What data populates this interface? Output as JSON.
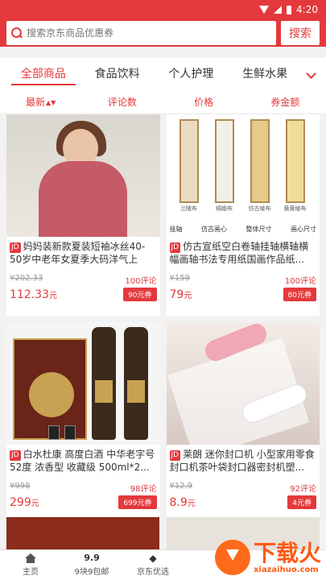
{
  "status": {
    "time": "4:20"
  },
  "header": {
    "search_placeholder": "搜索京东商品优惠券",
    "search_button": "搜索"
  },
  "categories": [
    "全部商品",
    "食品饮料",
    "个人护理",
    "生鲜水果"
  ],
  "sort_tabs": [
    "最新",
    "评论数",
    "价格",
    "券金额"
  ],
  "products": [
    {
      "badge": "JD",
      "title": "妈妈装新款夏装短袖冰丝40-50岁中老年女夏季大码洋气上衣...",
      "old_price": "¥202.33",
      "price": "112.33",
      "price_unit": "元",
      "comments": "100评论",
      "coupon": "90元券"
    },
    {
      "badge": "JD",
      "title": "仿古宣纸空白卷轴挂轴横轴横幅画轴书法专用纸国画作品纸...",
      "old_price": "¥159",
      "price": "79",
      "price_unit": "元",
      "comments": "100评论",
      "coupon": "80元券"
    },
    {
      "badge": "JD",
      "title": "白水杜康 高度白酒 中华老字号52度 浓香型 收藏级 500ml*2...",
      "old_price": "¥998",
      "price": "299",
      "price_unit": "元",
      "comments": "98评论",
      "coupon": "699元券"
    },
    {
      "badge": "JD",
      "title": "莱朗 迷你封口机 小型家用零食封口机茶叶袋封口器密封机塑...",
      "old_price": "¥12.9",
      "price": "8.9",
      "price_unit": "元",
      "comments": "92评论",
      "coupon": "4元券"
    }
  ],
  "scroll_labels": [
    "兰陵布",
    "绸缎布",
    "仿古绫布",
    "黄黄绫布"
  ],
  "scroll_captions": [
    "挂轴",
    "仿古画心",
    "整体尺寸",
    "画心尺寸"
  ],
  "tabbar": [
    {
      "label": "主页",
      "icon": "home-icon"
    },
    {
      "label": "9块9包邮",
      "icon": "nine-nine-icon",
      "glyph": "9.9"
    },
    {
      "label": "京东优选",
      "icon": "bird-icon"
    }
  ],
  "watermark": {
    "main": "下载火",
    "sub": "xiazaihuo.com"
  }
}
